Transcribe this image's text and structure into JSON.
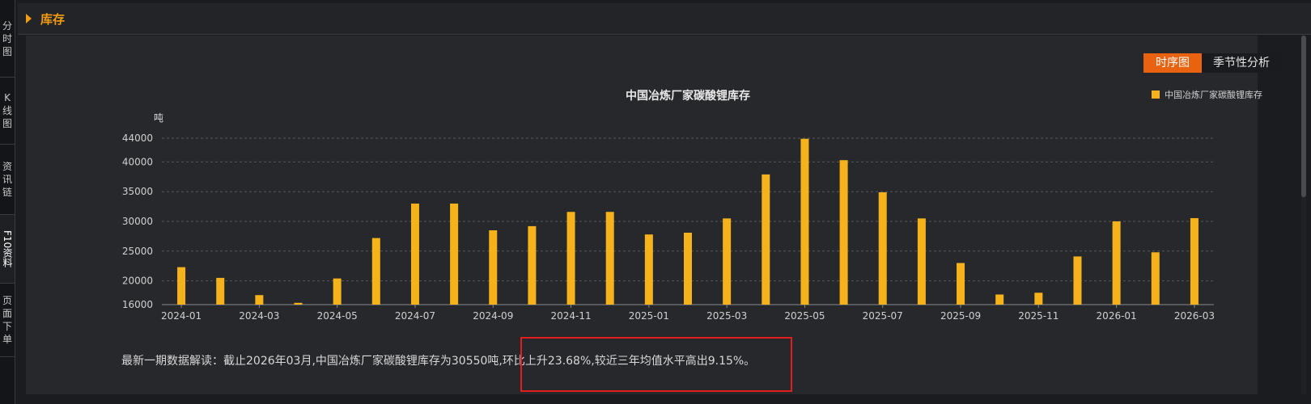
{
  "side_tabs": [
    {
      "label": "分时图"
    },
    {
      "label": "K线图"
    },
    {
      "label": "资讯链"
    },
    {
      "label": "F10资料"
    },
    {
      "label": "页面下单"
    }
  ],
  "header": {
    "title": "库存"
  },
  "view_toggle": {
    "active": "时序图",
    "inactive": "季节性分析"
  },
  "chart_data": {
    "type": "bar",
    "title": "中国冶炼厂家碳酸锂库存",
    "ylabel": "吨",
    "ylim": [
      16000,
      44000
    ],
    "y_ticks": [
      "44000",
      "40000",
      "35000",
      "30000",
      "25000",
      "20000",
      "16000"
    ],
    "x_tick_labels": [
      "2024-01",
      "2024-03",
      "2024-05",
      "2024-07",
      "2024-09",
      "2024-11",
      "2025-01",
      "2025-03",
      "2025-05",
      "2025-07",
      "2025-09",
      "2025-11",
      "2026-01",
      "2026-03"
    ],
    "categories": [
      "2024-01",
      "2024-02",
      "2024-03",
      "2024-04",
      "2024-05",
      "2024-06",
      "2024-07",
      "2024-08",
      "2024-09",
      "2024-10",
      "2024-11",
      "2024-12",
      "2025-01",
      "2025-02",
      "2025-03",
      "2025-04",
      "2025-05",
      "2025-06",
      "2025-07",
      "2025-08",
      "2025-09",
      "2025-10",
      "2025-11",
      "2025-12",
      "2026-01",
      "2026-02",
      "2026-03"
    ],
    "series": [
      {
        "name": "中国冶炼厂家碳酸锂库存",
        "color": "#f5b21b",
        "values": [
          22300,
          20500,
          17600,
          16300,
          20400,
          27200,
          33000,
          33000,
          28500,
          29200,
          31600,
          31600,
          27800,
          28100,
          30500,
          37900,
          43900,
          40300,
          34900,
          30500,
          23000,
          17700,
          18000,
          24100,
          30000,
          24800,
          30550
        ]
      }
    ],
    "grid": true,
    "legend_position": "top-right"
  },
  "note": "最新一期数据解读：截止2026年03月,中国冶炼厂家碳酸锂库存为30550吨,环比上升23.68%,较近三年均值水平高出9.15%。",
  "colors": {
    "accent": "#f39c12",
    "toggle_active": "#e8620f",
    "bar": "#f5b21b",
    "highlight_box": "#e41e1e"
  }
}
